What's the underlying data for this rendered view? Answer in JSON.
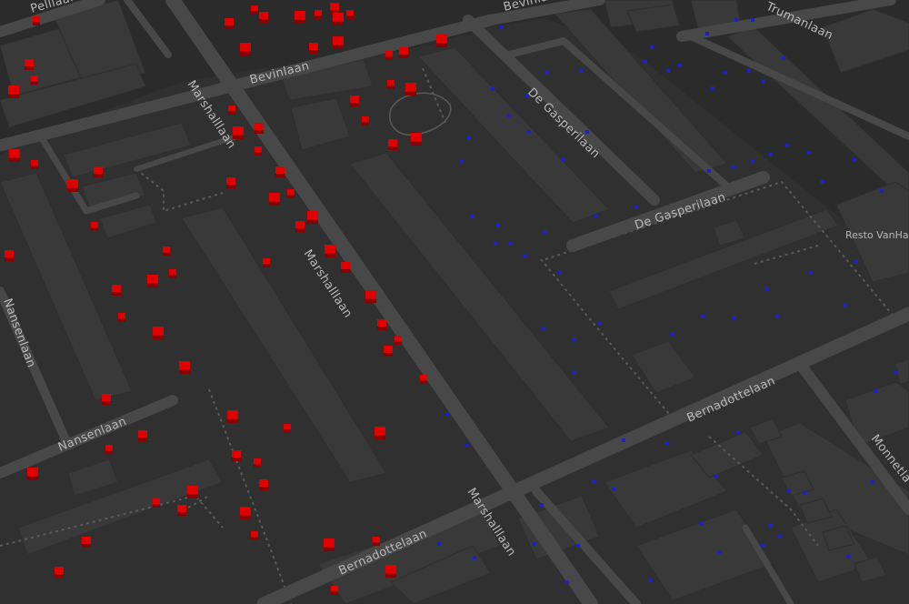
{
  "map": {
    "background_color": "#2b2b2b",
    "block_color": "#333333",
    "building_color": "#3a3a3a",
    "road_color": "#4a4a4a",
    "path_color": "#5a5a5a",
    "label_color": "#b9b9b9",
    "streets": {
      "pelllaan": "Pelllaan",
      "bevinlaan_top": "Bevinlaan",
      "bevinlaan": "Bevinlaan",
      "trumanlaan": "Trumanlaan",
      "marshalllaan_1": "Marshalllaan",
      "marshalllaan_2": "Marshalllaan",
      "marshalllaan_3": "Marshalllaan",
      "de_gasperilaan_1": "De Gasperilaan",
      "de_gasperilaan_2": "De Gasperilaan",
      "nansenlaan_v": "Nansenlaan",
      "nansenlaan_h": "Nansenlaan",
      "bernadottelaan_1": "Bernadottelaan",
      "bernadottelaan_2": "Bernadottelaan",
      "monnetlaan": "Monnetla"
    },
    "poi": {
      "resto": "Resto VanHart"
    },
    "markers": {
      "red_color": "#e00000",
      "blue_color": "#1f1fd0"
    }
  }
}
